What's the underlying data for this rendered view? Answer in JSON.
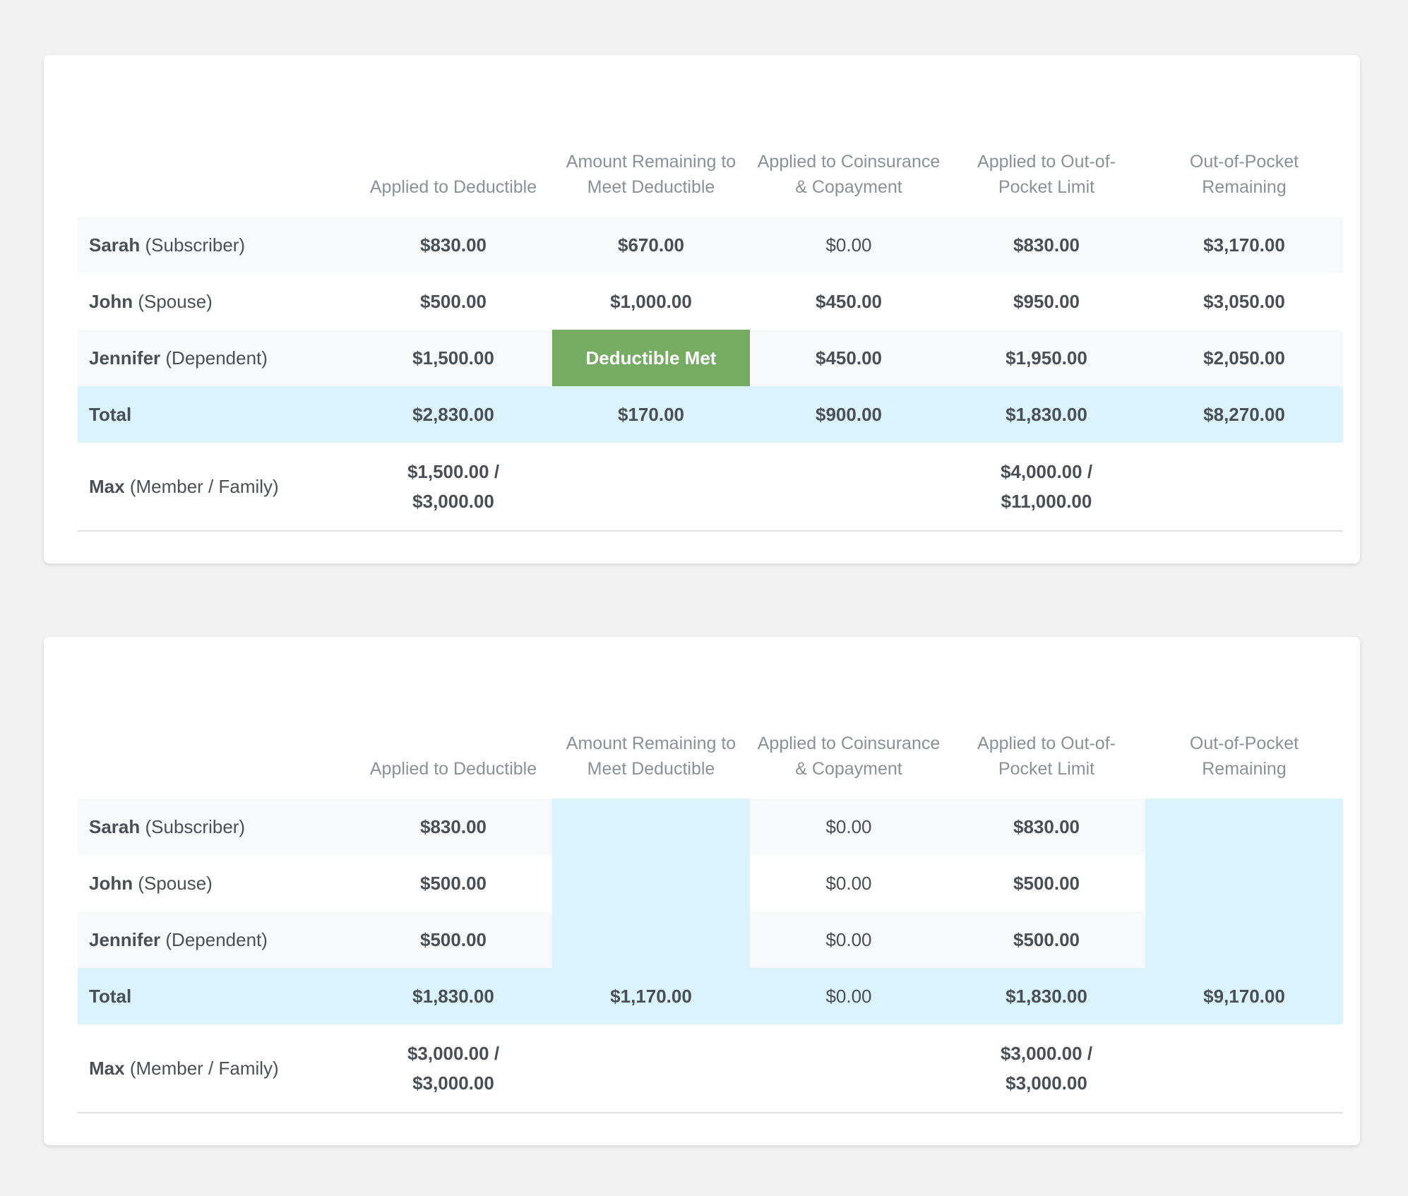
{
  "columns": [
    "",
    "Applied to Deductible",
    "Amount Remaining to Meet Deductible",
    "Applied to Coinsurance & Copayment",
    "Applied to Out-of-Pocket Limit",
    "Out-of-Pocket Remaining"
  ],
  "colors": {
    "page_background": "#f2f2f2",
    "card_background": "#ffffff",
    "row_stripe": "#f8f9fa",
    "highlight": "#dbf3fc",
    "deductible_met": "#76ab63",
    "header_text": "#8b9096",
    "body_text": "#4a4f55"
  },
  "tables": [
    {
      "rows": [
        {
          "name": "Sarah",
          "role": "(Subscriber)",
          "cells": [
            "$830.00",
            "$670.00",
            "$0.00",
            "$830.00",
            "$3,170.00"
          ]
        },
        {
          "name": "John",
          "role": "(Spouse)",
          "cells": [
            "$500.00",
            "$1,000.00",
            "$450.00",
            "$950.00",
            "$3,050.00"
          ]
        },
        {
          "name": "Jennifer",
          "role": "(Dependent)",
          "cells": [
            "$1,500.00",
            "Deductible Met",
            "$450.00",
            "$1,950.00",
            "$2,050.00"
          ]
        }
      ],
      "total": {
        "name": "Total",
        "cells": [
          "$2,830.00",
          "$170.00",
          "$900.00",
          "$1,830.00",
          "$8,270.00"
        ]
      },
      "max": {
        "name": "Max",
        "role": "(Member / Family)",
        "deductible": [
          "$1,500.00 /",
          "$3,000.00"
        ],
        "oop_limit": [
          "$4,000.00 /",
          "$11,000.00"
        ]
      }
    },
    {
      "rows": [
        {
          "name": "Sarah",
          "role": "(Subscriber)",
          "cells": [
            "$830.00",
            "",
            "$0.00",
            "$830.00",
            ""
          ]
        },
        {
          "name": "John",
          "role": "(Spouse)",
          "cells": [
            "$500.00",
            "",
            "$0.00",
            "$500.00",
            ""
          ]
        },
        {
          "name": "Jennifer",
          "role": "(Dependent)",
          "cells": [
            "$500.00",
            "",
            "$0.00",
            "$500.00",
            ""
          ]
        }
      ],
      "total": {
        "name": "Total",
        "cells": [
          "$1,830.00",
          "$1,170.00",
          "$0.00",
          "$1,830.00",
          "$9,170.00"
        ]
      },
      "max": {
        "name": "Max",
        "role": "(Member / Family)",
        "deductible": [
          "$3,000.00 /",
          "$3,000.00"
        ],
        "oop_limit": [
          "$3,000.00 /",
          "$3,000.00"
        ]
      }
    }
  ]
}
